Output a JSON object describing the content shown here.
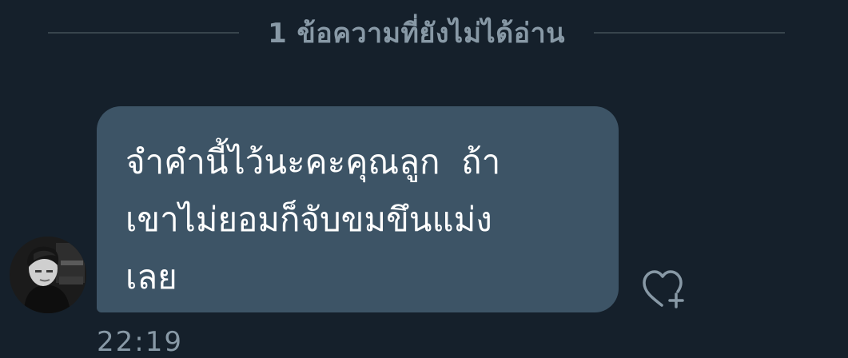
{
  "divider": {
    "label": "1 ข้อความที่ยังไม่ได้อ่าน"
  },
  "message": {
    "text": "จำคำนี้ไว้นะคะคุณลูก  ถ้า\nเขาไม่ยอมก็จับขมขึนแม่ง\nเลย",
    "timestamp": "22:19"
  },
  "icons": {
    "like": "heart-plus-icon",
    "avatar": "avatar"
  },
  "colors": {
    "background": "#15202b",
    "bubble": "#3d5466",
    "muted_text": "#8899a6",
    "divider_line": "#38444d",
    "message_text": "#ffffff"
  }
}
